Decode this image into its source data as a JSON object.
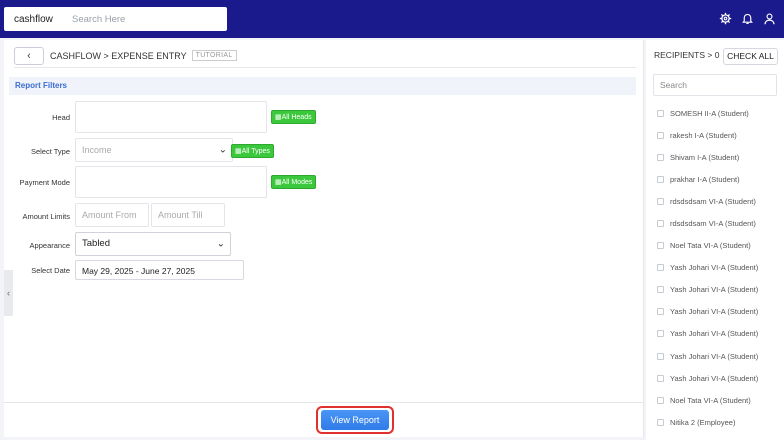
{
  "topbar": {
    "brand": "cashflow",
    "search_placeholder": "Search Here",
    "icons": [
      "gear-icon",
      "bell-icon",
      "user-icon"
    ]
  },
  "breadcrumb": {
    "back": "‹",
    "path": "CASHFLOW > EXPENSE ENTRY",
    "tutorial": "TUTORIAL"
  },
  "filters": {
    "title": "Report Filters",
    "head_label": "Head",
    "all_heads": "All Heads",
    "select_type_label": "Select Type",
    "select_type_value": "Income",
    "all_types": "All Types",
    "payment_mode_label": "Payment Mode",
    "all_modes": "All Modes",
    "amount_limits_label": "Amount Limits",
    "amount_from_placeholder": "Amount From",
    "amount_till_placeholder": "Amount Till",
    "appearance_label": "Appearance",
    "appearance_value": "Tabled",
    "select_date_label": "Select Date",
    "date_value": "May 29, 2025 - June 27, 2025"
  },
  "footer": {
    "view_report": "View Report"
  },
  "recipients": {
    "header": "RECIPIENTS > 0",
    "check_all": "CHECK ALL",
    "search_placeholder": "Search",
    "items": [
      "SOMESH II-A (Student)",
      "rakesh I-A (Student)",
      "Shivam I-A (Student)",
      "prakhar I-A (Student)",
      "rdsdsdsam VI-A (Student)",
      "rdsdsdsam VI-A (Student)",
      "Noel Tata VI-A (Student)",
      "Yash Johari VI-A (Student)",
      "Yash Johari VI-A (Student)",
      "Yash Johari VI-A (Student)",
      "Yash Johari VI-A (Student)",
      "Yash Johari VI-A (Student)",
      "Yash Johari VI-A (Student)",
      "Noel Tata VI-A (Student)",
      "Nitika 2 (Employee)"
    ]
  },
  "colors": {
    "topbar": "#1a1a8c",
    "accent": "#3a6cd1",
    "green": "#3cc83c",
    "highlight": "#e03030"
  }
}
